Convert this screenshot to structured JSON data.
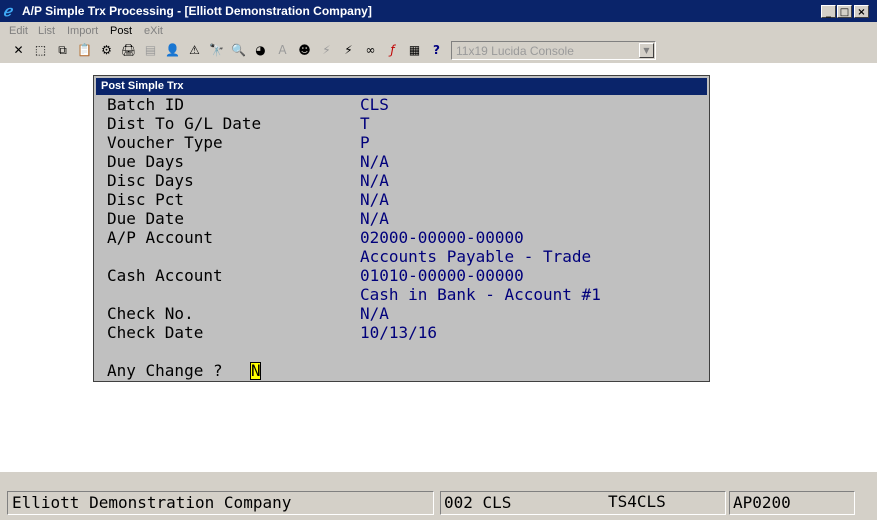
{
  "window": {
    "title": "A/P Simple Trx Processing - [Elliott Demonstration Company]",
    "icon": "elliott-app-icon",
    "controls": {
      "minimize": "_",
      "maximize": "□",
      "close": "×"
    }
  },
  "menu": [
    {
      "label": "Edit"
    },
    {
      "label": "List"
    },
    {
      "label": "Import"
    },
    {
      "label": "Post"
    },
    {
      "label": "eXit"
    }
  ],
  "toolbar": {
    "icons": [
      {
        "name": "cut-icon",
        "glyph": "✕"
      },
      {
        "name": "select-icon",
        "glyph": "⬚"
      },
      {
        "name": "copy-icon",
        "glyph": "⧉"
      },
      {
        "name": "paste-icon",
        "glyph": "📋"
      },
      {
        "name": "settings-icon",
        "glyph": "⚙"
      },
      {
        "name": "print-setup-icon",
        "glyph": "🖨"
      },
      {
        "name": "document-icon",
        "glyph": "▤"
      },
      {
        "name": "user-icon",
        "glyph": "👤"
      },
      {
        "name": "warning-icon",
        "glyph": "⚠"
      },
      {
        "name": "binoculars-icon",
        "glyph": "🔭"
      },
      {
        "name": "magnifier-icon",
        "glyph": "🔍"
      },
      {
        "name": "chart-icon",
        "glyph": "◕"
      },
      {
        "name": "font-icon",
        "glyph": "A"
      },
      {
        "name": "person-card-icon",
        "glyph": "☻"
      },
      {
        "name": "lightning-icon",
        "glyph": "⚡"
      },
      {
        "name": "run-icon",
        "glyph": "⚡"
      },
      {
        "name": "link-icon",
        "glyph": "∞"
      },
      {
        "name": "function-icon",
        "glyph": "ƒ"
      },
      {
        "name": "calculator-icon",
        "glyph": "▦"
      },
      {
        "name": "help-pointer-icon",
        "glyph": "?"
      }
    ],
    "font_select": "11x19 Lucida Console"
  },
  "dialog": {
    "title": "Post Simple Trx",
    "fields": [
      {
        "label": "Batch ID",
        "value": "CLS"
      },
      {
        "label": "Dist To G/L Date",
        "value": "T"
      },
      {
        "label": "Voucher Type",
        "value": "P"
      },
      {
        "label": "Due Days",
        "value": "N/A"
      },
      {
        "label": "Disc Days",
        "value": "N/A"
      },
      {
        "label": "Disc Pct",
        "value": "N/A"
      },
      {
        "label": "Due Date",
        "value": "N/A"
      },
      {
        "label": "A/P Account",
        "value": "02000-00000-00000"
      },
      {
        "label": "",
        "value": "Accounts Payable - Trade"
      },
      {
        "label": "Cash Account",
        "value": "01010-00000-00000"
      },
      {
        "label": "",
        "value": "Cash in Bank - Account #1"
      },
      {
        "label": "Check No.",
        "value": "N/A"
      },
      {
        "label": "Check Date",
        "value": "10/13/16"
      }
    ],
    "prompt": "Any Change ?",
    "answer": "N"
  },
  "status": {
    "company": "Elliott Demonstration Company",
    "batch": "002 CLS",
    "terminal": "TS4CLS",
    "program": "AP0200"
  }
}
